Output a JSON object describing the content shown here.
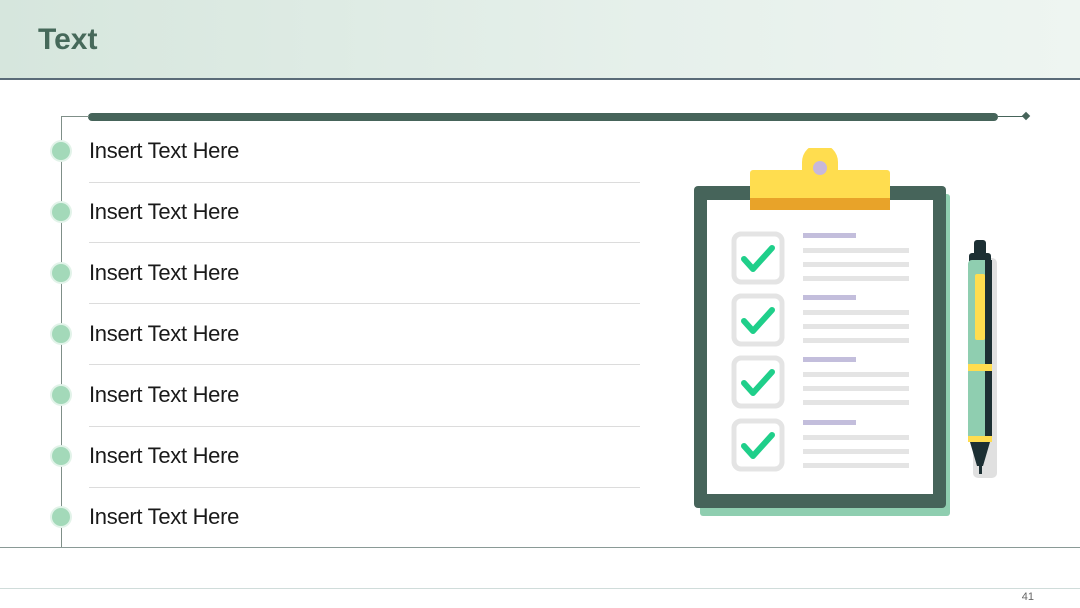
{
  "slide": {
    "title": "Text",
    "page_number": "41"
  },
  "list": {
    "items": [
      "Insert Text Here",
      "Insert Text Here",
      "Insert Text Here",
      "Insert Text Here",
      "Insert Text Here",
      "Insert Text Here",
      "Insert Text Here"
    ]
  },
  "illustration": {
    "icons": [
      "clipboard-icon",
      "checkmark-icon",
      "pen-icon"
    ]
  },
  "colors": {
    "header_text": "#46695a",
    "accent_green": "#46645a",
    "bullet_green": "#a3d9b9",
    "check_green": "#1fcf8a",
    "clip_yellow": "#ffdb4d"
  }
}
